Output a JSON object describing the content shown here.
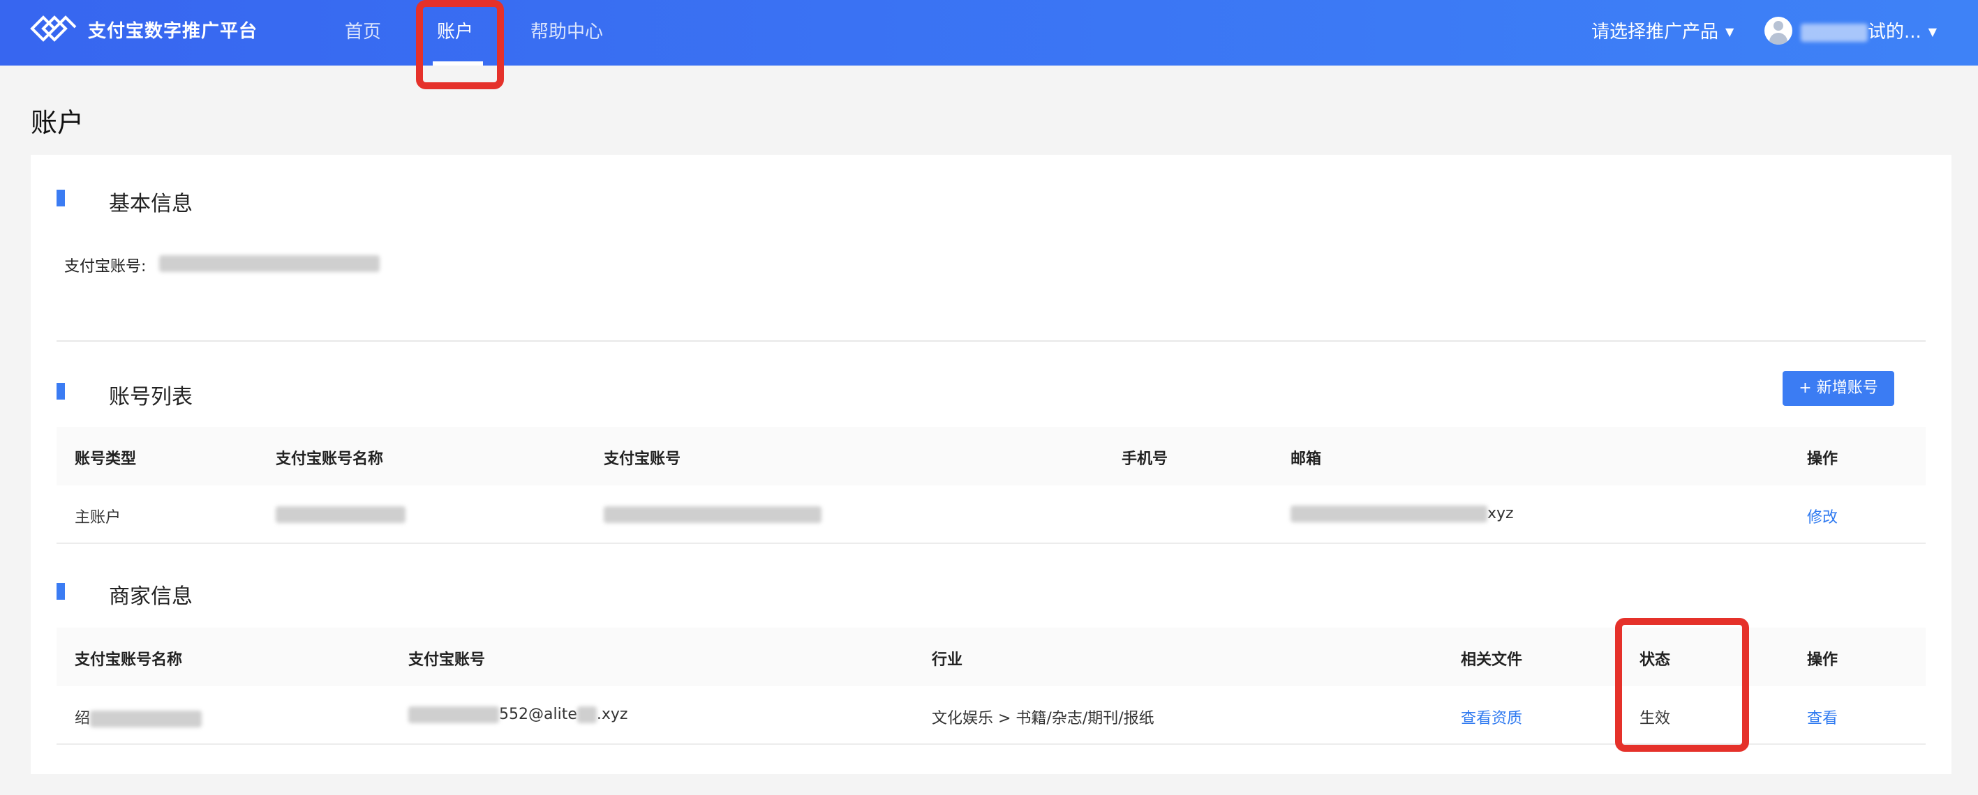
{
  "header": {
    "brand": "支付宝数字推广平台",
    "nav": [
      {
        "label": "首页"
      },
      {
        "label": "账户"
      },
      {
        "label": "帮助中心"
      }
    ],
    "product_select": "请选择推广产品",
    "user_name_suffix": "试的...",
    "caret": "▼"
  },
  "page": {
    "title": "账户"
  },
  "basic_info": {
    "title": "基本信息",
    "account_label": "支付宝账号:"
  },
  "account_list": {
    "title": "账号列表",
    "add_button": "+ 新增账号",
    "columns": [
      "账号类型",
      "支付宝账号名称",
      "支付宝账号",
      "手机号",
      "邮箱",
      "操作"
    ],
    "rows": [
      {
        "type": "主账户",
        "email_suffix": "xyz",
        "action": "修改"
      }
    ]
  },
  "merchant_info": {
    "title": "商家信息",
    "columns": [
      "支付宝账号名称",
      "支付宝账号",
      "行业",
      "相关文件",
      "状态",
      "操作"
    ],
    "rows": [
      {
        "name_prefix": "绍",
        "account_suffix": "552@alite",
        "account_tail": ".xyz",
        "industry": "文化娱乐 > 书籍/杂志/期刊/报纸",
        "files": "查看资质",
        "status": "生效",
        "action": "查看"
      }
    ]
  },
  "colors": {
    "accent": "#3b7cf3",
    "annotation": "#e5312a",
    "header_start": "#3766f0",
    "header_end": "#3e82f7"
  }
}
